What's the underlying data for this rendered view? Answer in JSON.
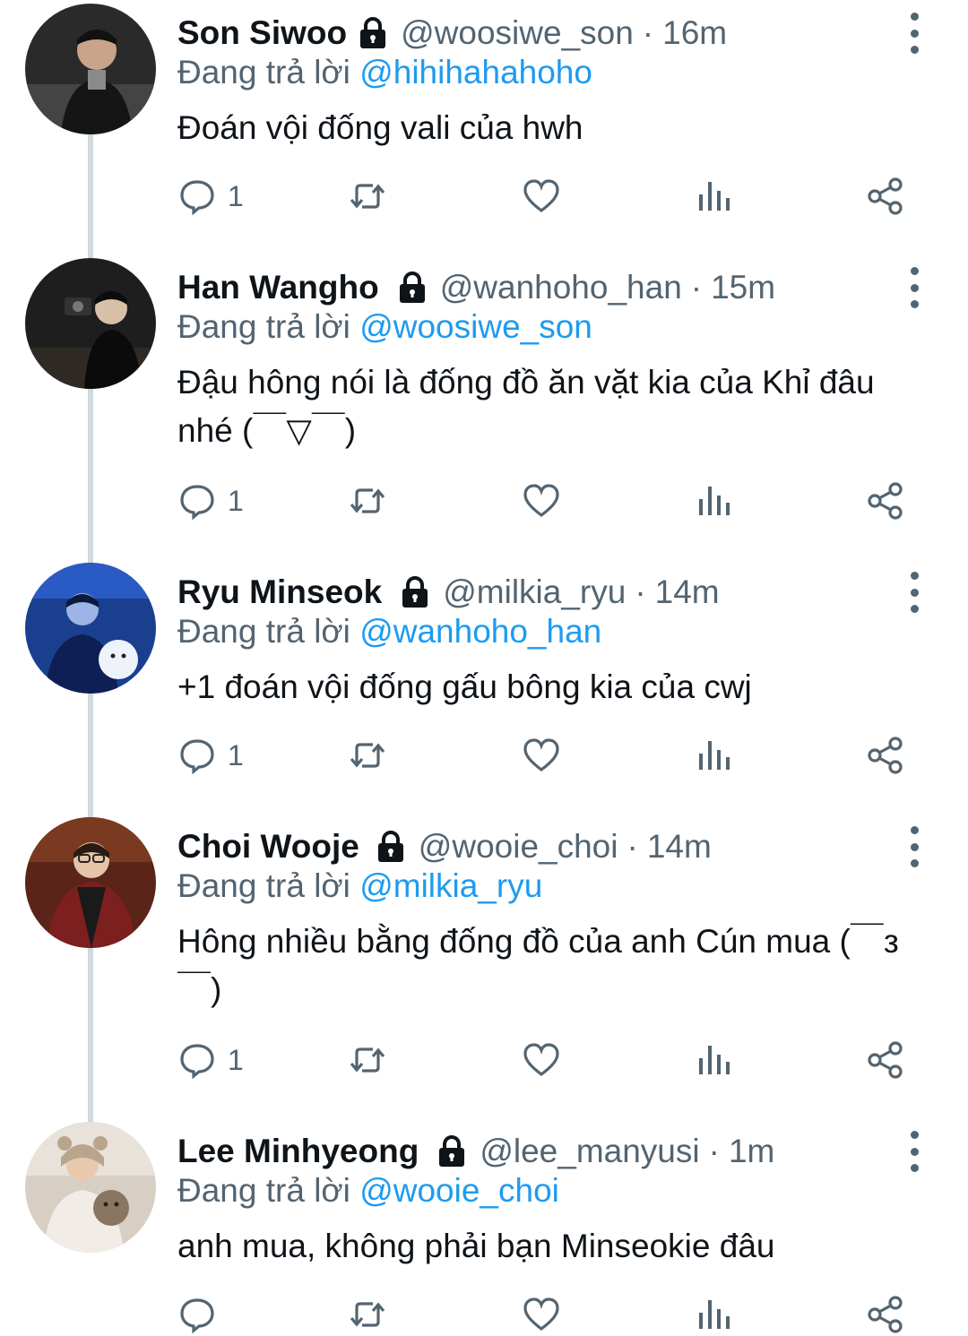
{
  "reply_prefix": "Đang trả lời",
  "tweets": [
    {
      "name": "Son Siwoo",
      "handle": "@woosiwe_son",
      "time": "16m",
      "reply_to": "@hihihahahoho",
      "text": "Đoán vội đống vali của hwh",
      "reply_count": "1",
      "avatar_color": "#2a2a2a"
    },
    {
      "name": "Han Wangho",
      "handle": "@wanhoho_han",
      "time": "15m",
      "reply_to": "@woosiwe_son",
      "text": "Đậu hông nói là đống đồ ăn vặt kia của Khỉ đâu nhé (￣▽￣)",
      "reply_count": "1",
      "avatar_color": "#1e1e1e"
    },
    {
      "name": "Ryu Minseok",
      "handle": "@milkia_ryu",
      "time": "14m",
      "reply_to": "@wanhoho_han",
      "text": "+1 đoán vội đống gấu bông kia của cwj",
      "reply_count": "1",
      "avatar_color": "#1b3f8f"
    },
    {
      "name": "Choi Wooje",
      "handle": "@wooie_choi",
      "time": "14m",
      "reply_to": "@milkia_ryu",
      "text": "Hông nhiều bằng đống đồ của anh Cún mua (￣з￣)",
      "reply_count": "1",
      "avatar_color": "#5a2418"
    },
    {
      "name": "Lee Minhyeong",
      "handle": "@lee_manyusi",
      "time": "1m",
      "reply_to": "@wooie_choi",
      "text": "anh mua, không phải bạn Minseokie đâu",
      "reply_count": "",
      "avatar_color": "#d8cfc4"
    }
  ],
  "icons": {
    "lock": "lock-icon",
    "reply": "reply-icon",
    "retweet": "retweet-icon",
    "like": "heart-icon",
    "views": "views-icon",
    "share": "share-icon",
    "more": "more-icon"
  },
  "colors": {
    "mention": "#1d9bf0",
    "secondary_text": "#536471",
    "thread_line": "#cfd9de"
  }
}
